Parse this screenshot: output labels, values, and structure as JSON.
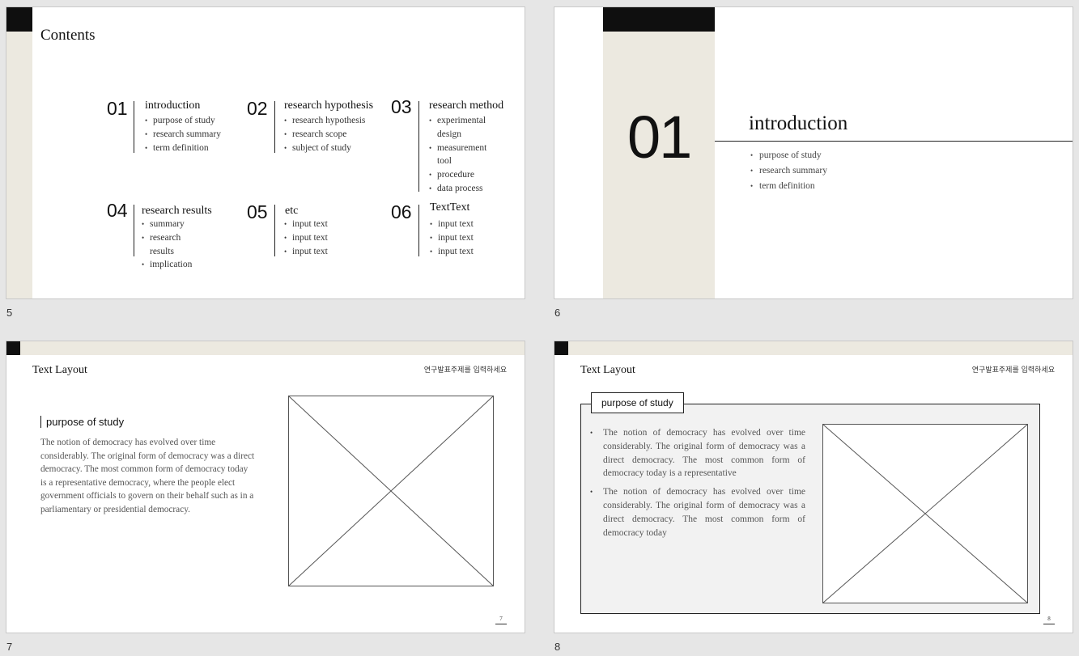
{
  "slides": [
    {
      "number": "5",
      "title": "Contents",
      "items": [
        {
          "num": "01",
          "heading": "introduction",
          "bullets": [
            "purpose of study",
            "research summary",
            "term definition"
          ]
        },
        {
          "num": "02",
          "heading": "research hypothesis",
          "bullets": [
            "research hypothesis",
            "research scope",
            "subject of study"
          ]
        },
        {
          "num": "03",
          "heading": "research method",
          "bullets": [
            "experimental design",
            "measurement tool",
            "procedure",
            "data process"
          ]
        },
        {
          "num": "04",
          "heading": "research results",
          "bullets": [
            "summary",
            "research results",
            "implication"
          ]
        },
        {
          "num": "05",
          "heading": "etc",
          "bullets": [
            "input text",
            "input text",
            "input text"
          ]
        },
        {
          "num": "06",
          "heading": "TextText",
          "bullets": [
            "input text",
            "input text",
            "input text"
          ]
        }
      ]
    },
    {
      "number": "6",
      "section_num": "01",
      "heading": "introduction",
      "bullets": [
        "purpose of study",
        "research summary",
        "term definition"
      ]
    },
    {
      "number": "7",
      "title": "Text Layout",
      "subject": "연구발표주제를 입력하세요",
      "section_heading": "purpose of study",
      "body": "The notion of democracy has evolved over time considerably. The original form of democracy was a direct democracy. The most common form of democracy today is a representative democracy, where the people elect government officials to govern on their behalf such as in a parliamentary or presidential democracy.",
      "page": "7"
    },
    {
      "number": "8",
      "title": "Text Layout",
      "subject": "연구발표주제를 입력하세요",
      "box_label": "purpose of study",
      "bullets": [
        "The notion of democracy has evolved over time considerably. The original form of democracy was a direct democracy. The most common form of democracy today is a representative",
        "The notion of democracy has evolved over time considerably. The original form of democracy was a direct democracy. The most common form of democracy today"
      ],
      "page": "8"
    }
  ],
  "colors": {
    "beige": "#ece9e0",
    "black": "#0f0f0f",
    "panel": "#f2f2f2"
  }
}
